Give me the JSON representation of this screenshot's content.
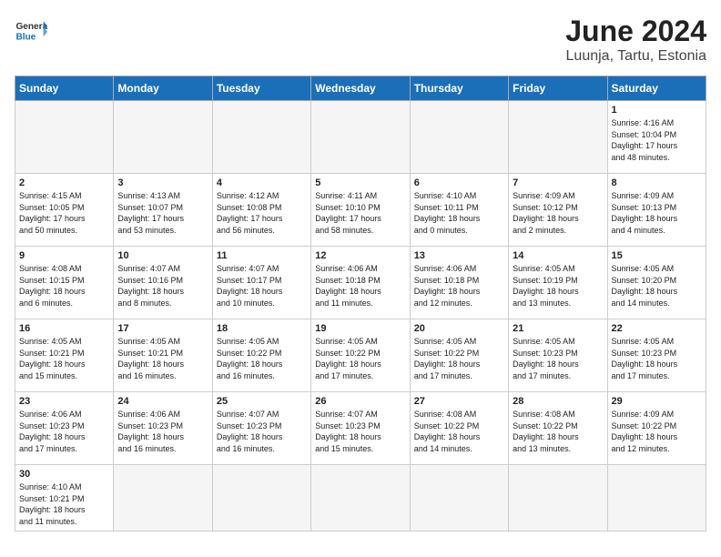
{
  "header": {
    "logo_general": "General",
    "logo_blue": "Blue",
    "title": "June 2024",
    "subtitle": "Luunja, Tartu, Estonia"
  },
  "weekdays": [
    "Sunday",
    "Monday",
    "Tuesday",
    "Wednesday",
    "Thursday",
    "Friday",
    "Saturday"
  ],
  "weeks": [
    [
      {
        "day": "",
        "empty": true
      },
      {
        "day": "",
        "empty": true
      },
      {
        "day": "",
        "empty": true
      },
      {
        "day": "",
        "empty": true
      },
      {
        "day": "",
        "empty": true
      },
      {
        "day": "",
        "empty": true
      },
      {
        "day": "1",
        "info": "Sunrise: 4:16 AM\nSunset: 10:04 PM\nDaylight: 17 hours\nand 48 minutes."
      }
    ],
    [
      {
        "day": "2",
        "info": "Sunrise: 4:15 AM\nSunset: 10:05 PM\nDaylight: 17 hours\nand 50 minutes."
      },
      {
        "day": "3",
        "info": "Sunrise: 4:13 AM\nSunset: 10:07 PM\nDaylight: 17 hours\nand 53 minutes."
      },
      {
        "day": "4",
        "info": "Sunrise: 4:12 AM\nSunset: 10:08 PM\nDaylight: 17 hours\nand 56 minutes."
      },
      {
        "day": "5",
        "info": "Sunrise: 4:11 AM\nSunset: 10:10 PM\nDaylight: 17 hours\nand 58 minutes."
      },
      {
        "day": "6",
        "info": "Sunrise: 4:10 AM\nSunset: 10:11 PM\nDaylight: 18 hours\nand 0 minutes."
      },
      {
        "day": "7",
        "info": "Sunrise: 4:09 AM\nSunset: 10:12 PM\nDaylight: 18 hours\nand 2 minutes."
      },
      {
        "day": "8",
        "info": "Sunrise: 4:09 AM\nSunset: 10:13 PM\nDaylight: 18 hours\nand 4 minutes."
      }
    ],
    [
      {
        "day": "9",
        "info": "Sunrise: 4:08 AM\nSunset: 10:15 PM\nDaylight: 18 hours\nand 6 minutes."
      },
      {
        "day": "10",
        "info": "Sunrise: 4:07 AM\nSunset: 10:16 PM\nDaylight: 18 hours\nand 8 minutes."
      },
      {
        "day": "11",
        "info": "Sunrise: 4:07 AM\nSunset: 10:17 PM\nDaylight: 18 hours\nand 10 minutes."
      },
      {
        "day": "12",
        "info": "Sunrise: 4:06 AM\nSunset: 10:18 PM\nDaylight: 18 hours\nand 11 minutes."
      },
      {
        "day": "13",
        "info": "Sunrise: 4:06 AM\nSunset: 10:18 PM\nDaylight: 18 hours\nand 12 minutes."
      },
      {
        "day": "14",
        "info": "Sunrise: 4:05 AM\nSunset: 10:19 PM\nDaylight: 18 hours\nand 13 minutes."
      },
      {
        "day": "15",
        "info": "Sunrise: 4:05 AM\nSunset: 10:20 PM\nDaylight: 18 hours\nand 14 minutes."
      }
    ],
    [
      {
        "day": "16",
        "info": "Sunrise: 4:05 AM\nSunset: 10:21 PM\nDaylight: 18 hours\nand 15 minutes."
      },
      {
        "day": "17",
        "info": "Sunrise: 4:05 AM\nSunset: 10:21 PM\nDaylight: 18 hours\nand 16 minutes."
      },
      {
        "day": "18",
        "info": "Sunrise: 4:05 AM\nSunset: 10:22 PM\nDaylight: 18 hours\nand 16 minutes."
      },
      {
        "day": "19",
        "info": "Sunrise: 4:05 AM\nSunset: 10:22 PM\nDaylight: 18 hours\nand 17 minutes."
      },
      {
        "day": "20",
        "info": "Sunrise: 4:05 AM\nSunset: 10:22 PM\nDaylight: 18 hours\nand 17 minutes."
      },
      {
        "day": "21",
        "info": "Sunrise: 4:05 AM\nSunset: 10:23 PM\nDaylight: 18 hours\nand 17 minutes."
      },
      {
        "day": "22",
        "info": "Sunrise: 4:05 AM\nSunset: 10:23 PM\nDaylight: 18 hours\nand 17 minutes."
      }
    ],
    [
      {
        "day": "23",
        "info": "Sunrise: 4:06 AM\nSunset: 10:23 PM\nDaylight: 18 hours\nand 17 minutes."
      },
      {
        "day": "24",
        "info": "Sunrise: 4:06 AM\nSunset: 10:23 PM\nDaylight: 18 hours\nand 16 minutes."
      },
      {
        "day": "25",
        "info": "Sunrise: 4:07 AM\nSunset: 10:23 PM\nDaylight: 18 hours\nand 16 minutes."
      },
      {
        "day": "26",
        "info": "Sunrise: 4:07 AM\nSunset: 10:23 PM\nDaylight: 18 hours\nand 15 minutes."
      },
      {
        "day": "27",
        "info": "Sunrise: 4:08 AM\nSunset: 10:22 PM\nDaylight: 18 hours\nand 14 minutes."
      },
      {
        "day": "28",
        "info": "Sunrise: 4:08 AM\nSunset: 10:22 PM\nDaylight: 18 hours\nand 13 minutes."
      },
      {
        "day": "29",
        "info": "Sunrise: 4:09 AM\nSunset: 10:22 PM\nDaylight: 18 hours\nand 12 minutes."
      }
    ],
    [
      {
        "day": "30",
        "info": "Sunrise: 4:10 AM\nSunset: 10:21 PM\nDaylight: 18 hours\nand 11 minutes."
      },
      {
        "day": "",
        "empty": true
      },
      {
        "day": "",
        "empty": true
      },
      {
        "day": "",
        "empty": true
      },
      {
        "day": "",
        "empty": true
      },
      {
        "day": "",
        "empty": true
      },
      {
        "day": "",
        "empty": true
      }
    ]
  ]
}
